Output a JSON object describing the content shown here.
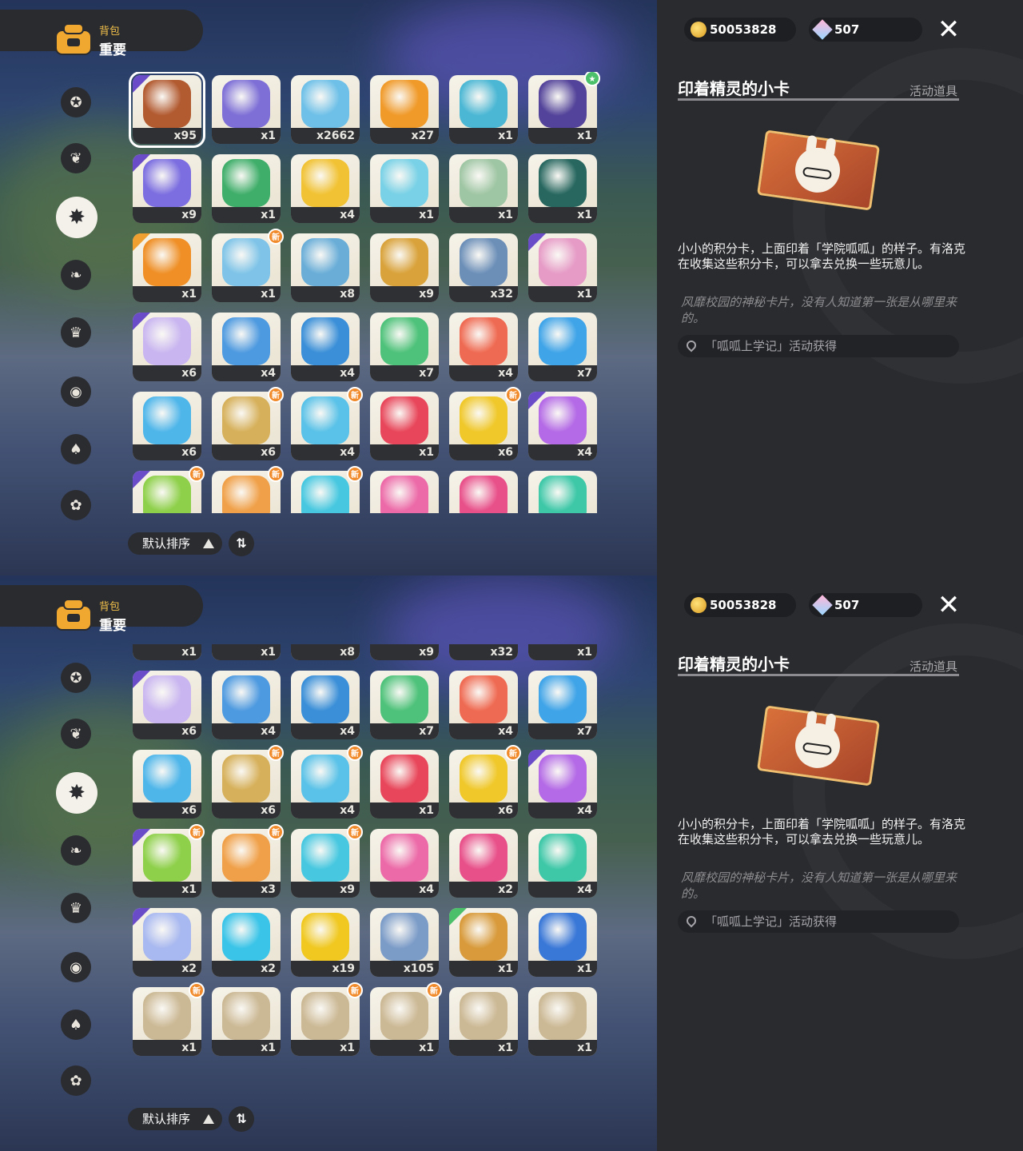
{
  "header": {
    "subtitle": "背包",
    "title": "重要"
  },
  "currency": {
    "coins": "50053828",
    "gems": "507"
  },
  "detail": {
    "title": "印着精灵的小卡",
    "category": "活动道具",
    "description": "小小的积分卡，上面印着「学院呱呱」的样子。有洛克在收集这些积分卡，可以拿去兑换一些玩意儿。",
    "flavor": "风靡校园的神秘卡片，没有人知道第一张是从哪里来的。",
    "source": "「呱呱上学记」活动获得"
  },
  "sort": {
    "label": "默认排序"
  },
  "badge_new": "新",
  "sidebar_icons": [
    "star-badge-icon",
    "sprout-icon",
    "gear-star-icon",
    "leaf-icon",
    "crown-card-icon",
    "egg-icon",
    "acorn-icon",
    "cushion-icon"
  ],
  "frame1_items": [
    {
      "qty": "x95",
      "color": "#b25a30",
      "rarity": "#6a4cc9"
    },
    {
      "qty": "x1",
      "color": "#7d6fd6",
      "rarity": ""
    },
    {
      "qty": "x2662",
      "color": "#6ec0e8",
      "rarity": ""
    },
    {
      "qty": "x27",
      "color": "#f09a2a",
      "rarity": ""
    },
    {
      "qty": "x1",
      "color": "#4bb7d4",
      "rarity": ""
    },
    {
      "qty": "x1",
      "color": "#54439a",
      "rarity": "",
      "badge": "green"
    },
    {
      "qty": "x9",
      "color": "#7c6ee0",
      "rarity": "#6a4cc9"
    },
    {
      "qty": "x1",
      "color": "#3fae6a",
      "rarity": ""
    },
    {
      "qty": "x4",
      "color": "#f1c233",
      "rarity": ""
    },
    {
      "qty": "x1",
      "color": "#78d1e6",
      "rarity": ""
    },
    {
      "qty": "x1",
      "color": "#9fc6a4",
      "rarity": ""
    },
    {
      "qty": "x1",
      "color": "#27675f",
      "rarity": ""
    },
    {
      "qty": "x1",
      "color": "#ef8f26",
      "rarity": "#f0a030"
    },
    {
      "qty": "x1",
      "color": "#7fc4e8",
      "rarity": "",
      "badge": "new"
    },
    {
      "qty": "x8",
      "color": "#6aaed8",
      "rarity": ""
    },
    {
      "qty": "x9",
      "color": "#d9a23a",
      "rarity": ""
    },
    {
      "qty": "x32",
      "color": "#6c8fb8",
      "rarity": ""
    },
    {
      "qty": "x1",
      "color": "#e69bc6",
      "rarity": "#6a4cc9"
    },
    {
      "qty": "x6",
      "color": "#c9b6f0",
      "rarity": "#6a4cc9"
    },
    {
      "qty": "x4",
      "color": "#4e9ae0",
      "rarity": ""
    },
    {
      "qty": "x4",
      "color": "#3a8fd8",
      "rarity": ""
    },
    {
      "qty": "x7",
      "color": "#4ec27a",
      "rarity": ""
    },
    {
      "qty": "x4",
      "color": "#ef6a52",
      "rarity": ""
    },
    {
      "qty": "x7",
      "color": "#3fa4e8",
      "rarity": ""
    },
    {
      "qty": "x6",
      "color": "#4fb6ea",
      "rarity": ""
    },
    {
      "qty": "x6",
      "color": "#d6b05a",
      "rarity": "",
      "badge": "new"
    },
    {
      "qty": "x4",
      "color": "#5ac2e8",
      "rarity": "",
      "badge": "new"
    },
    {
      "qty": "x1",
      "color": "#e8465a",
      "rarity": ""
    },
    {
      "qty": "x6",
      "color": "#f0c82a",
      "rarity": "",
      "badge": "new"
    },
    {
      "qty": "x4",
      "color": "#b46ae6",
      "rarity": "#6a4cc9"
    },
    {
      "qty": "",
      "color": "#8ed04a",
      "rarity": "#6a4cc9",
      "badge": "new"
    },
    {
      "qty": "",
      "color": "#f0a048",
      "rarity": "",
      "badge": "new"
    },
    {
      "qty": "",
      "color": "#48c8e0",
      "rarity": "",
      "badge": "new"
    },
    {
      "qty": "",
      "color": "#ec6aa8",
      "rarity": ""
    },
    {
      "qty": "",
      "color": "#e8508a",
      "rarity": ""
    },
    {
      "qty": "",
      "color": "#3ec8a8",
      "rarity": ""
    }
  ],
  "frame2_items": [
    {
      "qty": "x1",
      "color": "#ef8f26",
      "rarity": ""
    },
    {
      "qty": "x1",
      "color": "#7fc4e8",
      "rarity": ""
    },
    {
      "qty": "x8",
      "color": "#6aaed8",
      "rarity": ""
    },
    {
      "qty": "x9",
      "color": "#d9a23a",
      "rarity": ""
    },
    {
      "qty": "x32",
      "color": "#6c8fb8",
      "rarity": ""
    },
    {
      "qty": "x1",
      "color": "#e69bc6",
      "rarity": ""
    },
    {
      "qty": "x6",
      "color": "#c9b6f0",
      "rarity": "#6a4cc9"
    },
    {
      "qty": "x4",
      "color": "#4e9ae0",
      "rarity": ""
    },
    {
      "qty": "x4",
      "color": "#3a8fd8",
      "rarity": ""
    },
    {
      "qty": "x7",
      "color": "#4ec27a",
      "rarity": ""
    },
    {
      "qty": "x4",
      "color": "#ef6a52",
      "rarity": ""
    },
    {
      "qty": "x7",
      "color": "#3fa4e8",
      "rarity": ""
    },
    {
      "qty": "x6",
      "color": "#4fb6ea",
      "rarity": ""
    },
    {
      "qty": "x6",
      "color": "#d6b05a",
      "rarity": "",
      "badge": "new"
    },
    {
      "qty": "x4",
      "color": "#5ac2e8",
      "rarity": "",
      "badge": "new"
    },
    {
      "qty": "x1",
      "color": "#e8465a",
      "rarity": ""
    },
    {
      "qty": "x6",
      "color": "#f0c82a",
      "rarity": "",
      "badge": "new"
    },
    {
      "qty": "x4",
      "color": "#b46ae6",
      "rarity": "#6a4cc9"
    },
    {
      "qty": "x1",
      "color": "#8ed04a",
      "rarity": "#6a4cc9",
      "badge": "new"
    },
    {
      "qty": "x3",
      "color": "#f0a048",
      "rarity": "",
      "badge": "new"
    },
    {
      "qty": "x9",
      "color": "#48c8e0",
      "rarity": "",
      "badge": "new"
    },
    {
      "qty": "x4",
      "color": "#ec6aa8",
      "rarity": ""
    },
    {
      "qty": "x2",
      "color": "#e8508a",
      "rarity": ""
    },
    {
      "qty": "x4",
      "color": "#3ec8a8",
      "rarity": ""
    },
    {
      "qty": "x2",
      "color": "#a8b8f0",
      "rarity": "#6a4cc9"
    },
    {
      "qty": "x2",
      "color": "#3ac4e8",
      "rarity": ""
    },
    {
      "qty": "x19",
      "color": "#f0c820",
      "rarity": ""
    },
    {
      "qty": "x105",
      "color": "#7c9cc8",
      "rarity": ""
    },
    {
      "qty": "x1",
      "color": "#d89a3a",
      "rarity": "#4cbf6a"
    },
    {
      "qty": "x1",
      "color": "#3a78d8",
      "rarity": ""
    },
    {
      "qty": "x1",
      "color": "#cbb894",
      "rarity": "",
      "badge": "new"
    },
    {
      "qty": "x1",
      "color": "#cbb894",
      "rarity": ""
    },
    {
      "qty": "x1",
      "color": "#cbb894",
      "rarity": "",
      "badge": "new"
    },
    {
      "qty": "x1",
      "color": "#cbb894",
      "rarity": "",
      "badge": "new"
    },
    {
      "qty": "x1",
      "color": "#cbb894",
      "rarity": ""
    },
    {
      "qty": "x1",
      "color": "#cbb894",
      "rarity": ""
    }
  ]
}
